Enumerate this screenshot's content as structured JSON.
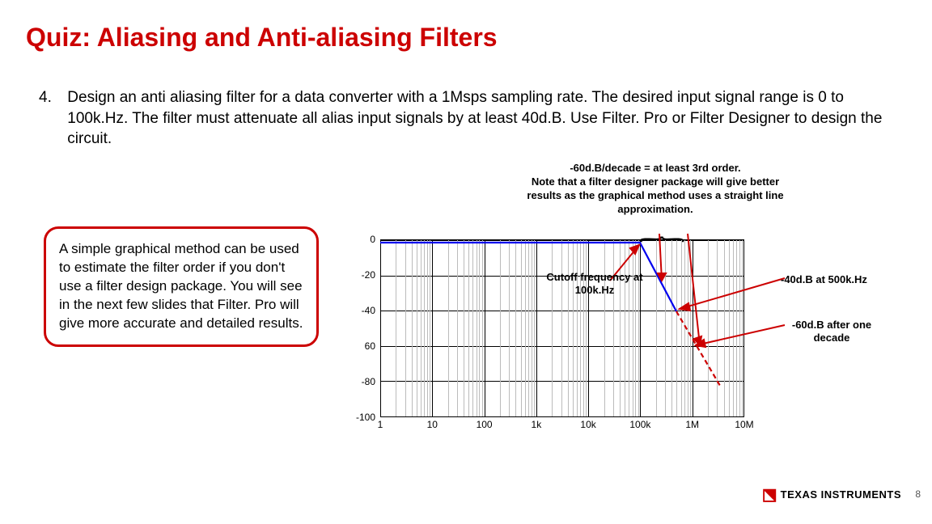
{
  "title": "Quiz: Aliasing and Anti-aliasing Filters",
  "question": {
    "number": "4.",
    "text": "Design an anti aliasing filter for a data converter with a 1Msps sampling rate.  The desired input signal range is 0 to 100k.Hz.  The filter must attenuate all alias input signals by at least 40d.B.  Use Filter. Pro or Filter Designer to design the circuit."
  },
  "top_note": "-60d.B/decade = at least 3rd order.\nNote that a filter designer package will give better results as the graphical method uses a straight line approximation.",
  "callout": "A simple graphical method can be used to estimate the filter order if you don't use a filter design package.  You will see in the next few slides that Filter. Pro will give more accurate and detailed results.",
  "cutoff_label": "Cutoff frequency at 100k.Hz",
  "right_label_1": "-40d.B at 500k.Hz",
  "right_label_2": "-60d.B after one decade",
  "logo_text": "TEXAS INSTRUMENTS",
  "page_number": "8",
  "chart_data": {
    "type": "line",
    "xlabel": "",
    "ylabel": "",
    "x_scale": "log",
    "x_ticks": [
      "1",
      "10",
      "100",
      "1k",
      "10k",
      "100k",
      "1M",
      "10M"
    ],
    "y_ticks": [
      0,
      -20,
      -40,
      60,
      -80,
      -100
    ],
    "ylim": [
      -100,
      0
    ],
    "series": [
      {
        "name": "filter-response",
        "color": "#0000ee",
        "x": [
          1,
          100000,
          500000
        ],
        "y": [
          0,
          0,
          -40
        ]
      },
      {
        "name": "extrapolation-dashed",
        "color": "#cc0000",
        "style": "dashed",
        "x": [
          500000,
          2000000
        ],
        "y": [
          -40,
          -76
        ]
      }
    ],
    "annotations": [
      {
        "text": "Cutoff frequency at 100k.Hz",
        "x": 100000,
        "y": 0
      },
      {
        "text": "-40d.B at 500k.Hz",
        "x": 500000,
        "y": -40
      },
      {
        "text": "-60d.B after one decade",
        "x": 1000000,
        "y": -60
      }
    ]
  }
}
